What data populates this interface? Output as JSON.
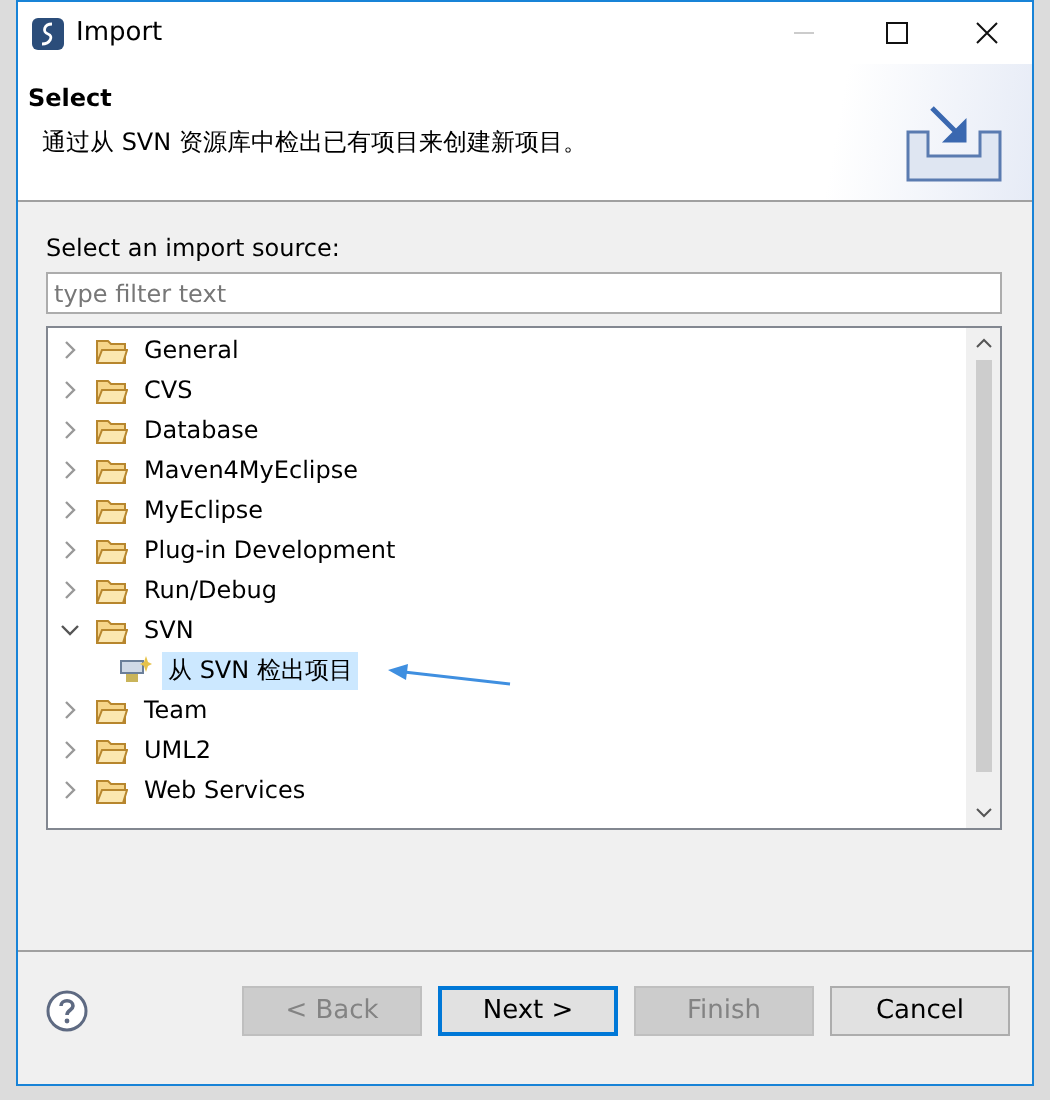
{
  "window": {
    "title": "Import"
  },
  "header": {
    "title": "Select",
    "description": "通过从 SVN 资源库中检出已有项目来创建新项目。"
  },
  "filter": {
    "label": "Select an import source:",
    "placeholder": "type filter text"
  },
  "tree": [
    {
      "label": "General",
      "expanded": false,
      "selected": false,
      "kind": "folder"
    },
    {
      "label": "CVS",
      "expanded": false,
      "selected": false,
      "kind": "folder"
    },
    {
      "label": "Database",
      "expanded": false,
      "selected": false,
      "kind": "folder"
    },
    {
      "label": "Maven4MyEclipse",
      "expanded": false,
      "selected": false,
      "kind": "folder"
    },
    {
      "label": "MyEclipse",
      "expanded": false,
      "selected": false,
      "kind": "folder"
    },
    {
      "label": "Plug-in Development",
      "expanded": false,
      "selected": false,
      "kind": "folder"
    },
    {
      "label": "Run/Debug",
      "expanded": false,
      "selected": false,
      "kind": "folder"
    },
    {
      "label": "SVN",
      "expanded": true,
      "selected": false,
      "kind": "folder",
      "children": [
        {
          "label": "从 SVN 检出项目",
          "selected": true,
          "kind": "wizard"
        }
      ]
    },
    {
      "label": "Team",
      "expanded": false,
      "selected": false,
      "kind": "folder"
    },
    {
      "label": "UML2",
      "expanded": false,
      "selected": false,
      "kind": "folder"
    },
    {
      "label": "Web Services",
      "expanded": false,
      "selected": false,
      "kind": "folder"
    }
  ],
  "buttons": [
    {
      "label": "< Back",
      "disabled": true,
      "default": false
    },
    {
      "label": "Next >",
      "disabled": false,
      "default": true
    },
    {
      "label": "Finish",
      "disabled": true,
      "default": false
    },
    {
      "label": "Cancel",
      "disabled": false,
      "default": false
    }
  ]
}
